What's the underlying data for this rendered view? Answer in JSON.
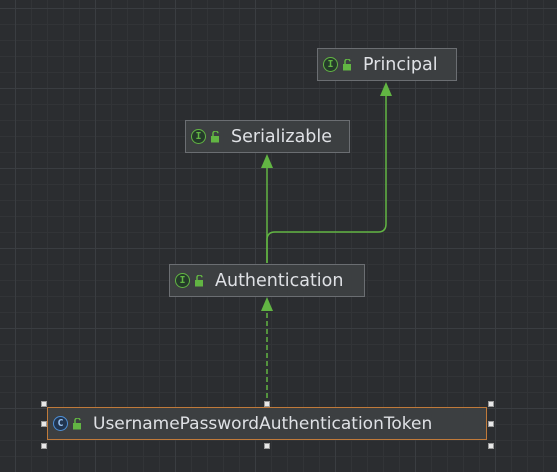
{
  "diagram": {
    "nodes": [
      {
        "id": "principal",
        "kind": "interface",
        "badge": "I",
        "label": "Principal",
        "selected": false
      },
      {
        "id": "serializable",
        "kind": "interface",
        "badge": "I",
        "label": "Serializable",
        "selected": false
      },
      {
        "id": "authentication",
        "kind": "interface",
        "badge": "I",
        "label": "Authentication",
        "selected": false
      },
      {
        "id": "token",
        "kind": "class",
        "badge": "C",
        "label": "UsernamePasswordAuthenticationToken",
        "selected": true
      }
    ],
    "edges": [
      {
        "from": "authentication",
        "to": "serializable",
        "type": "extends",
        "style": "solid"
      },
      {
        "from": "authentication",
        "to": "principal",
        "type": "extends",
        "style": "solid"
      },
      {
        "from": "token",
        "to": "authentication",
        "type": "implements",
        "style": "dashed"
      }
    ]
  },
  "colors": {
    "background": "#2b2d30",
    "edge": "#62b543",
    "node_fill": "#3c3f41",
    "node_border": "#6b6e72",
    "selection_border": "#c07a3a",
    "interface_icon": "#62b543",
    "class_icon": "#4d8fd6"
  }
}
